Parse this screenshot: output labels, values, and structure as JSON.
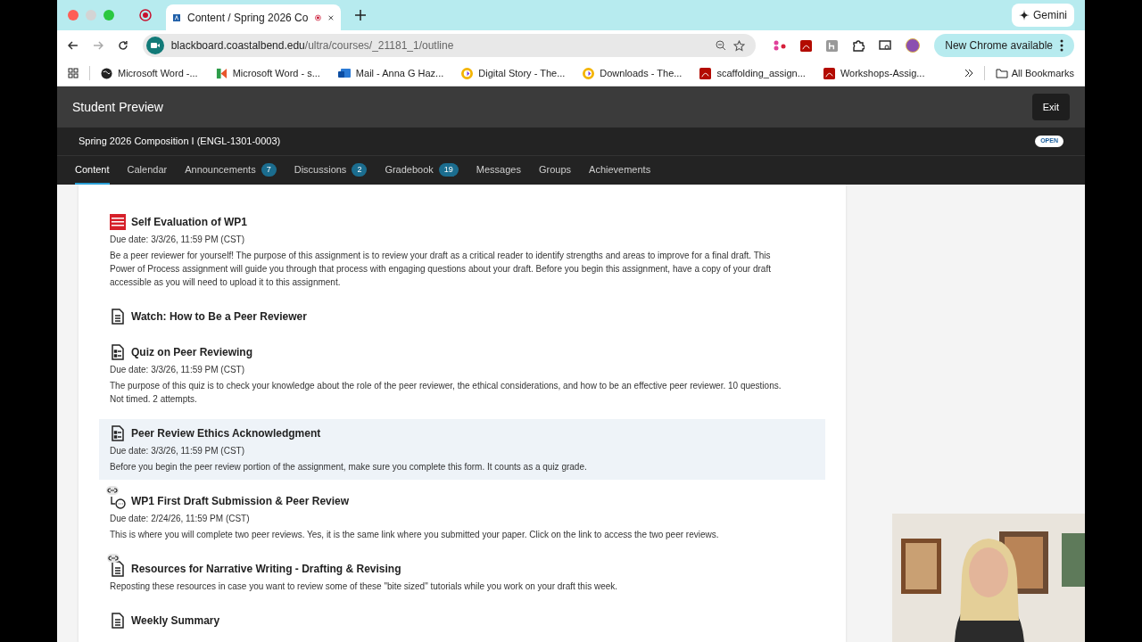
{
  "browser": {
    "tabs": [
      {
        "title": "Content / Spring 2026 Co",
        "selected": true
      }
    ],
    "gemini": "Gemini",
    "url_host": "blackboard.coastalbend.edu",
    "url_path": "/ultra/courses/_21181_1/outline",
    "update": "New Chrome available",
    "bookmarks": [
      {
        "kind": "globe",
        "label": "Microsoft Word -..."
      },
      {
        "kind": "k",
        "label": "Microsoft Word - s..."
      },
      {
        "kind": "mail",
        "label": "Mail - Anna G Haz..."
      },
      {
        "kind": "ring",
        "label": "Digital Story - The..."
      },
      {
        "kind": "ring",
        "label": "Downloads - The..."
      },
      {
        "kind": "pdf",
        "label": "scaffolding_assign..."
      },
      {
        "kind": "pdf",
        "label": "Workshops-Assig..."
      }
    ],
    "all_bookmarks": "All Bookmarks"
  },
  "preview": {
    "title": "Student Preview",
    "exit": "Exit"
  },
  "course": {
    "title": "Spring 2026 Composition I (ENGL-1301-0003)",
    "status": "OPEN"
  },
  "nav": [
    {
      "label": "Content",
      "selected": true
    },
    {
      "label": "Calendar",
      "selected": false
    },
    {
      "label": "Announcements",
      "count": "7",
      "selected": false
    },
    {
      "label": "Discussions",
      "count": "2",
      "selected": false
    },
    {
      "label": "Gradebook",
      "count": "19",
      "selected": false
    },
    {
      "label": "Messages",
      "selected": false
    },
    {
      "label": "Groups",
      "selected": false
    },
    {
      "label": "Achievements",
      "selected": false
    }
  ],
  "items": [
    {
      "kind": "publisher",
      "title": "Self Evaluation of WP1",
      "due": "Due date: 3/3/26, 11:59 PM (CST)",
      "description": "Be a peer reviewer for yourself! The purpose of this assignment is to review your draft as a critical reader to identify strengths and areas to improve for a final draft. This Power of Process assignment will guide you through that process with engaging questions about your draft. Before you begin this assignment, have a copy of your draft accessible as you will need to upload it to this assignment.",
      "selected": false
    },
    {
      "kind": "document",
      "title": "Watch: How to Be a Peer Reviewer",
      "selected": false
    },
    {
      "kind": "form",
      "title": "Quiz on Peer Reviewing",
      "due": "Due date: 3/3/26, 11:59 PM (CST)",
      "description": "The purpose of this quiz is to check your knowledge about the role of the peer reviewer, the ethical considerations, and how to be an effective peer reviewer. 10 questions. Not timed. 2 attempts.",
      "selected": false
    },
    {
      "kind": "form",
      "title": "Peer Review Ethics Acknowledgment",
      "due": "Due date: 3/3/26, 11:59 PM (CST)",
      "description": "Before you begin the peer review portion of the assignment, make sure you complete this form. It counts as a quiz grade.",
      "selected": true
    },
    {
      "kind": "linked-discussion",
      "title": "WP1 First Draft Submission & Peer Review",
      "due": "Due date: 2/24/26, 11:59 PM (CST)",
      "description": "This is where you will complete two peer reviews. Yes, it is the same link where you submitted your paper. Click on the link to access the two peer reviews.",
      "selected": false
    },
    {
      "kind": "linked-document",
      "title": "Resources for Narrative Writing - Drafting & Revising",
      "description": "Reposting these resources in case you want to review some of these \"bite sized\" tutorials while you work on your draft this week.",
      "selected": false
    },
    {
      "kind": "document",
      "title": "Weekly Summary",
      "selected": false
    }
  ]
}
